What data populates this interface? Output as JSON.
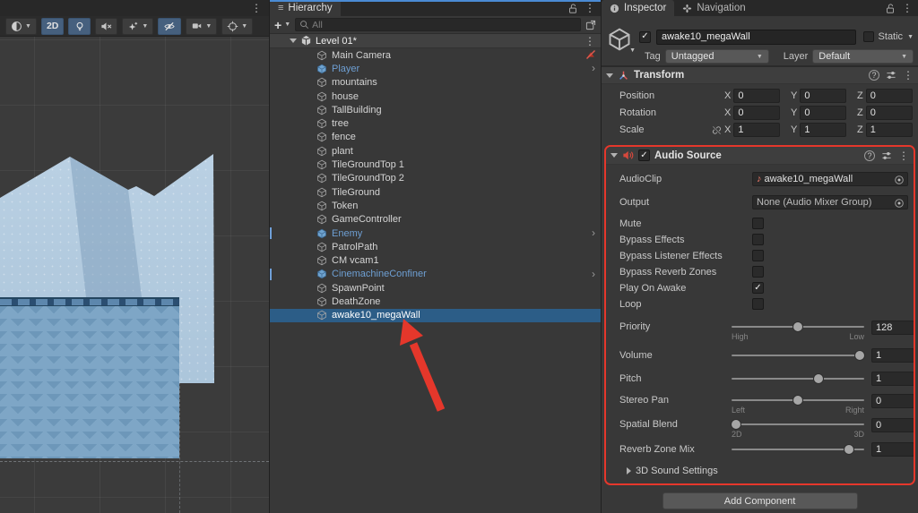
{
  "colors": {
    "selection": "#2c5d87",
    "prefab_text": "#6e9fd3",
    "annotation": "#e5372b",
    "toolbar_active": "#46607e",
    "focus_line": "#4a8bd4"
  },
  "scene_view": {
    "toolbar": [
      {
        "name": "shading-mode",
        "icon": "sphere",
        "dropdown": true,
        "active": false
      },
      {
        "name": "2d-toggle",
        "label": "2D",
        "active": true
      },
      {
        "name": "lighting-toggle",
        "icon": "bulb",
        "active": true
      },
      {
        "name": "audio-mute-toggle",
        "icon": "speaker-muted",
        "active": false
      },
      {
        "name": "effects-toggle",
        "icon": "effects-star",
        "dropdown": true,
        "active": false
      },
      {
        "name": "hidden-objects-toggle",
        "icon": "eye-slash",
        "active": true
      },
      {
        "name": "camera-overlay",
        "icon": "video-camera",
        "dropdown": true,
        "active": false
      },
      {
        "name": "gizmos-toggle",
        "icon": "crosshair",
        "dropdown": true,
        "active": false
      }
    ]
  },
  "hierarchy": {
    "tab": "Hierarchy",
    "search_placeholder": "All",
    "scene_name": "Level 01*",
    "items": [
      {
        "label": "Main Camera",
        "right_icon": "hidden-red"
      },
      {
        "label": "Player",
        "prefab": true,
        "expander": true
      },
      {
        "label": "mountains"
      },
      {
        "label": "house"
      },
      {
        "label": "TallBuilding"
      },
      {
        "label": "tree"
      },
      {
        "label": "fence"
      },
      {
        "label": "plant"
      },
      {
        "label": "TileGroundTop 1"
      },
      {
        "label": "TileGroundTop 2"
      },
      {
        "label": "TileGround"
      },
      {
        "label": "Token"
      },
      {
        "label": "GameController"
      },
      {
        "label": "Enemy",
        "prefab": true,
        "expander": true,
        "bar": true
      },
      {
        "label": "PatrolPath"
      },
      {
        "label": "CM vcam1"
      },
      {
        "label": "CinemachineConfiner",
        "prefab": true,
        "expander": true,
        "bar": true
      },
      {
        "label": "SpawnPoint"
      },
      {
        "label": "DeathZone"
      },
      {
        "label": "awake10_megaWall",
        "selected": true
      }
    ]
  },
  "inspector": {
    "tabs": [
      "Inspector",
      "Navigation"
    ],
    "game_object": {
      "active": true,
      "name": "awake10_megaWall",
      "static_label": "Static",
      "static": false,
      "tag_label": "Tag",
      "tag": "Untagged",
      "layer_label": "Layer",
      "layer": "Default"
    },
    "transform": {
      "title": "Transform",
      "rows": [
        {
          "label": "Position",
          "x": "0",
          "y": "0",
          "z": "0"
        },
        {
          "label": "Rotation",
          "x": "0",
          "y": "0",
          "z": "0"
        },
        {
          "label": "Scale",
          "link": true,
          "x": "1",
          "y": "1",
          "z": "1"
        }
      ]
    },
    "audio_source": {
      "title": "Audio Source",
      "enabled": true,
      "rows": [
        {
          "type": "object",
          "label": "AudioClip",
          "value": "awake10_megaWall",
          "icon": "music-note"
        },
        {
          "type": "object",
          "label": "Output",
          "value": "None (Audio Mixer Group)",
          "muted": true
        },
        {
          "type": "check",
          "label": "Mute",
          "checked": false
        },
        {
          "type": "check",
          "label": "Bypass Effects",
          "checked": false
        },
        {
          "type": "check",
          "label": "Bypass Listener Effects",
          "checked": false
        },
        {
          "type": "check",
          "label": "Bypass Reverb Zones",
          "checked": false
        },
        {
          "type": "check",
          "label": "Play On Awake",
          "checked": true
        },
        {
          "type": "check",
          "label": "Loop",
          "checked": false
        },
        {
          "type": "slider",
          "label": "Priority",
          "value": "128",
          "pos": 0.5,
          "sub_left": "High",
          "sub_right": "Low"
        },
        {
          "type": "slider",
          "label": "Volume",
          "value": "1",
          "pos": 1
        },
        {
          "type": "slider",
          "label": "Pitch",
          "value": "1",
          "pos": 0.667
        },
        {
          "type": "slider",
          "label": "Stereo Pan",
          "value": "0",
          "pos": 0.5,
          "sub_left": "Left",
          "sub_right": "Right"
        },
        {
          "type": "slider",
          "label": "Spatial Blend",
          "value": "0",
          "pos": 0,
          "sub_left": "2D",
          "sub_right": "3D"
        },
        {
          "type": "slider",
          "label": "Reverb Zone Mix",
          "value": "1",
          "pos": 0.91
        }
      ],
      "foldout": "3D Sound Settings"
    },
    "add_component": "Add Component"
  }
}
